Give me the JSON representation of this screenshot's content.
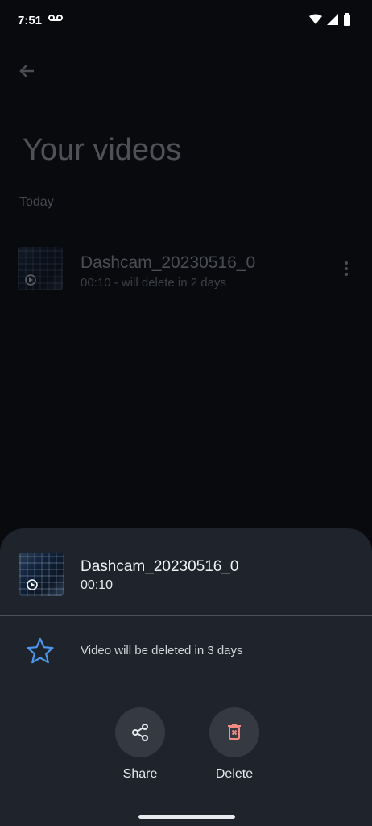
{
  "status_bar": {
    "time": "7:51",
    "voicemail_icon": "voicemail-icon",
    "wifi_icon": "wifi-icon",
    "signal_icon": "signal-icon",
    "battery_icon": "battery-icon"
  },
  "page": {
    "back_icon": "back-arrow-icon",
    "title": "Your videos",
    "section_label": "Today",
    "video_item": {
      "name": "Dashcam_20230516_0",
      "meta": "00:10 - will delete in 2 days",
      "more_icon": "more-vert-icon"
    }
  },
  "bottom_sheet": {
    "video_name": "Dashcam_20230516_0",
    "duration": "00:10",
    "notice": "Video will be deleted in 3 days",
    "star_icon": "star-outline-icon",
    "actions": [
      {
        "label": "Share",
        "icon": "share-icon"
      },
      {
        "label": "Delete",
        "icon": "delete-icon"
      }
    ]
  },
  "colors": {
    "accent_blue": "#4a97ee",
    "delete_red": "#f28b82",
    "sheet_background": "#1f232b"
  }
}
